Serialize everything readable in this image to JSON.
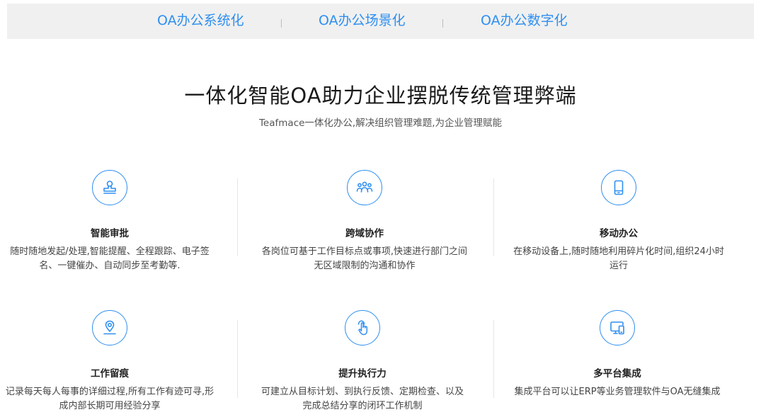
{
  "tabs": [
    {
      "label": "OA办公系统化"
    },
    {
      "label": "OA办公场景化"
    },
    {
      "label": "OA办公数字化"
    }
  ],
  "hero": {
    "title": "一体化智能OA助力企业摆脱传统管理弊端",
    "subtitle": "Teafmace一体化办公,解决组织管理难题,为企业管理赋能"
  },
  "features": [
    {
      "icon": "stamp-icon",
      "title": "智能审批",
      "desc": "随时随地发起/处理,智能提醒、全程跟踪、电子签名、一键催办、自动同步至考勤等."
    },
    {
      "icon": "team-icon",
      "title": "跨域协作",
      "desc": "各岗位可基于工作目标点或事项,快速进行部门之间无区域限制的沟通和协作"
    },
    {
      "icon": "mobile-icon",
      "title": "移动办公",
      "desc": "在移动设备上,随时随地利用碎片化时间,组织24小时运行"
    },
    {
      "icon": "location-pin-icon",
      "title": "工作留痕",
      "desc": "记录每天每人每事的详细过程,所有工作有迹可寻,形成内部长期可用经验分享"
    },
    {
      "icon": "tap-hand-icon",
      "title": "提升执行力",
      "desc": "可建立从目标计划、到执行反馈、定期检查、以及完成总结分享的闭环工作机制"
    },
    {
      "icon": "multi-device-icon",
      "title": "多平台集成",
      "desc": "集成平台可以让ERP等业务管理软件与OA无缝集成"
    }
  ],
  "colors": {
    "accent": "#2f8ff0",
    "tabbar_bg": "#f0f0f0"
  }
}
